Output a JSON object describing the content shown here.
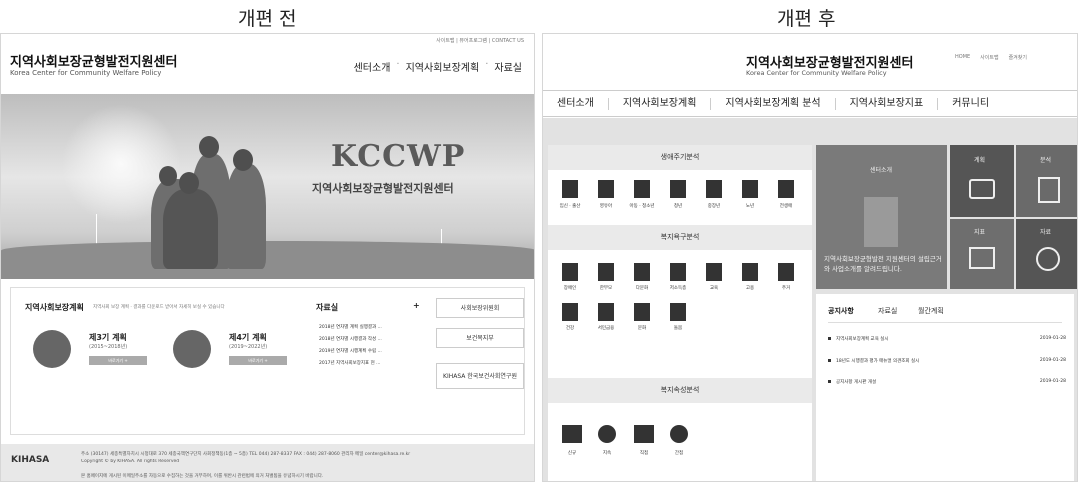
{
  "captions": {
    "before": "개편 전",
    "after": "개편 후"
  },
  "left": {
    "util": "사이트맵 | 뷰어프로그램 | CONTACT US",
    "title": "지역사회보장균형발전지원센터",
    "subtitle": "Korea Center for Community Welfare Policy",
    "nav": [
      "센터소개",
      "지역사회보장계획",
      "자료실"
    ],
    "hero_title": "KCCWP",
    "hero_sub": "지역사회보장균형발전지원센터",
    "plan": {
      "title": "지역사회보장계획",
      "desc": "지역사회 보장 계획 · 결과를 다운로드 받아서 자세히 보실 수 있습니다",
      "p3": {
        "name": "제3기 계획",
        "period": "(2015~2018년)",
        "btn": "바로가기 +"
      },
      "p4": {
        "name": "제4기 계획",
        "period": "(2019~2022년)",
        "btn": "바로가기 +"
      }
    },
    "archive": {
      "title": "자료실",
      "plus": "+",
      "items": [
        "2018년 연차별 계획 실행결과 ...",
        "2018년 연차별 시행결과 작성 ...",
        "2019년 연차별 시행계획 수립 ...",
        "2017년 지역사회보장지표 현 ..."
      ]
    },
    "logos": [
      "사회보장위원회",
      "보건복지부",
      "KIHASA 한국보건사회연구원"
    ],
    "footer": {
      "logo": "KIHASA",
      "line1": "주소 (30147) 세종특별자치시 시청대로 370 세종국책연구단지 사회정책동(1층 ~ 5층) TEL 044) 287-8337 FAX : 044) 287-8060 관리자 메일 center@kihasa.re.kr",
      "line2": "Copyright © by KIHASA. All rights Reserved",
      "line3": "본 홈페이지에 게시된 이메일주소를 자동으로 수집하는 것을 거부하며, 이를 위반시 관련법에 의거 처벌됨을 유념하시기 바랍니다."
    }
  },
  "right": {
    "title": "지역사회보장균형발전지원센터",
    "subtitle": "Korea Center for Community Welfare Policy",
    "util": [
      "HOME",
      "사이트맵",
      "즐겨찾기"
    ],
    "nav": [
      "센터소개",
      "지역사회보장계획",
      "지역사회보장계획 분석",
      "지역사회보장지표",
      "커뮤니티"
    ],
    "life": {
      "title": "생애주기분석",
      "items": [
        "임신 · 출산",
        "영유아",
        "아동 · 청소년",
        "청년",
        "중장년",
        "노년",
        "전생애"
      ]
    },
    "needs": {
      "title": "복지욕구분석",
      "items": [
        "장애인",
        "한부모",
        "다문화",
        "저소득층",
        "교육",
        "고용",
        "주거",
        "건강",
        "서민금융",
        "문화",
        "돌봄"
      ]
    },
    "attr": {
      "title": "복지속성분석",
      "items": [
        "신규",
        "지속",
        "직접",
        "간접"
      ]
    },
    "center": {
      "label": "센터소개",
      "desc": "지역사회보장균형발전 지원센터의 설립근거와 사업소개를 알려드립니다."
    },
    "tiles": [
      "계획",
      "분석",
      "지표",
      "자료"
    ],
    "notice": {
      "tabs": [
        "공지사항",
        "자료실",
        "월간계획"
      ],
      "rows": [
        {
          "text": "지역사회보장계획 교육 실시",
          "date": "2019-01-28"
        },
        {
          "text": "18년도 시행결과 평가 매뉴얼 의견조회 실시",
          "date": "2019-01-28"
        },
        {
          "text": "공지사항 게시판 개설",
          "date": "2019-01-28"
        }
      ]
    }
  }
}
